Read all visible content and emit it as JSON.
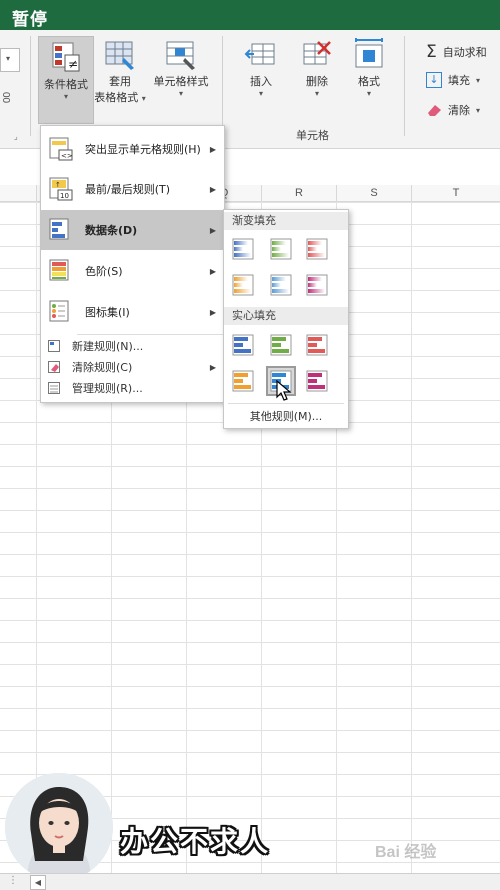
{
  "overlay": {
    "pause_label": "暂停"
  },
  "ribbon": {
    "conditional_format": "条件格式",
    "format_as_table_line1": "套用",
    "format_as_table_line2": "表格格式",
    "cell_styles": "单元格样式",
    "insert": "插入",
    "delete": "删除",
    "format": "格式",
    "cells_group": "单元格",
    "autosum": "自动求和",
    "fill": "填充",
    "clear": "清除",
    "sigma": "Σ",
    "left_partial": "00"
  },
  "columns": [
    "Q",
    "R",
    "S",
    "T"
  ],
  "menu": {
    "highlight_rules": "突出显示单元格规则(H)",
    "top_bottom": "最前/最后规则(T)",
    "data_bars": "数据条(D)",
    "color_scales": "色阶(S)",
    "icon_sets": "图标集(I)",
    "new_rule": "新建规则(N)...",
    "clear_rules": "清除规则(C)",
    "manage_rules": "管理规则(R)..."
  },
  "submenu": {
    "gradient_fill": "渐变填充",
    "solid_fill": "实心填充",
    "more_rules": "其他规则(M)...",
    "gradient_colors": [
      "#4472c4",
      "#70ad47",
      "#e15a5a",
      "#f0a030",
      "#5b9bd5",
      "#c0307a"
    ],
    "solid_colors": [
      "#4472c4",
      "#70ad47",
      "#e15a5a",
      "#f0a030",
      "#2e86d4",
      "#c0307a"
    ]
  },
  "branding": {
    "name": "办公不求人",
    "watermark": "Bai 经验"
  },
  "colors": {
    "title_bar": "#1e6b3f",
    "ribbon_bg": "#f3f3f3",
    "menu_highlight": "#c7c7c7"
  }
}
